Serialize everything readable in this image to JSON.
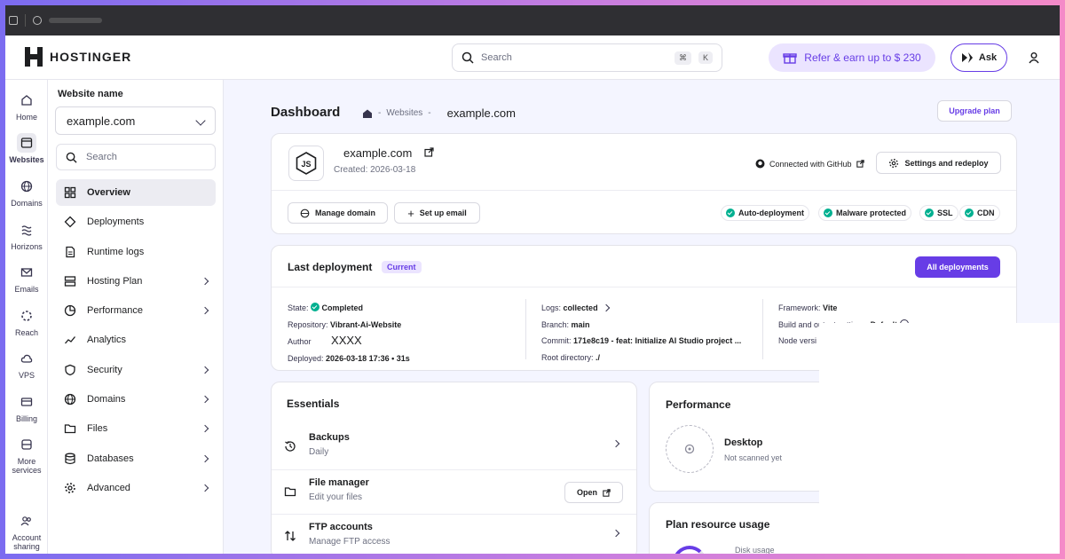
{
  "header": {
    "brand": "HOSTINGER",
    "search_placeholder": "Search",
    "shortcut_cmd": "⌘",
    "shortcut_key": "K",
    "refer_label": "Refer & earn up to $ 230",
    "ask_label": "Ask"
  },
  "rail": [
    {
      "label": "Home",
      "icon": "home-icon"
    },
    {
      "label": "Websites",
      "icon": "websites-icon",
      "active": true
    },
    {
      "label": "Domains",
      "icon": "globe-icon"
    },
    {
      "label": "Horizons",
      "icon": "horizons-icon"
    },
    {
      "label": "Emails",
      "icon": "mail-icon"
    },
    {
      "label": "Reach",
      "icon": "reach-icon"
    },
    {
      "label": "VPS",
      "icon": "cloud-icon"
    },
    {
      "label": "Billing",
      "icon": "card-icon"
    },
    {
      "label": "More",
      "label2": "services",
      "icon": "more-services-icon"
    },
    {
      "label": "Account",
      "label2": "sharing",
      "icon": "users-icon"
    }
  ],
  "sidebar": {
    "heading": "Website name",
    "selected_site": "example.com",
    "search_placeholder": "Search",
    "items": [
      {
        "label": "Overview",
        "icon": "grid-icon",
        "active": true
      },
      {
        "label": "Deployments",
        "icon": "deploy-icon"
      },
      {
        "label": "Runtime logs",
        "icon": "file-icon"
      },
      {
        "label": "Hosting Plan",
        "icon": "server-icon",
        "chevron": true
      },
      {
        "label": "Performance",
        "icon": "pie-icon",
        "chevron": true
      },
      {
        "label": "Analytics",
        "icon": "chart-line-icon"
      },
      {
        "label": "Security",
        "icon": "shield-icon",
        "chevron": true
      },
      {
        "label": "Domains",
        "icon": "globe-icon",
        "chevron": true
      },
      {
        "label": "Files",
        "icon": "folder-icon",
        "chevron": true
      },
      {
        "label": "Databases",
        "icon": "database-icon",
        "chevron": true
      },
      {
        "label": "Advanced",
        "icon": "gear-icon",
        "chevron": true
      }
    ]
  },
  "page": {
    "title": "Dashboard",
    "crumb_sep": "-",
    "crumb_websites": "Websites",
    "crumb_domain": "example.com",
    "upgrade_label": "Upgrade plan"
  },
  "site_card": {
    "domain": "example.com",
    "created": "Created: 2026-03-18",
    "github_label": "Connected with GitHub",
    "settings_label": "Settings and redeploy",
    "manage_domain": "Manage domain",
    "setup_email": "Set up email",
    "badges": [
      "Auto-deployment",
      "Malware protected",
      "SSL",
      "CDN"
    ]
  },
  "deployment": {
    "title": "Last deployment",
    "tag": "Current",
    "all_label": "All deployments",
    "state_k": "State:",
    "state_v": "Completed",
    "repo_k": "Repository:",
    "repo_v": "Vibrant-Ai-Website",
    "author_k": "Author",
    "author_v": "XXXX",
    "deployed_k": "Deployed:",
    "deployed_v": "2026-03-18 17:36 • 31s",
    "logs_k": "Logs:",
    "logs_v": "collected",
    "branch_k": "Branch:",
    "branch_v": "main",
    "commit_k": "Commit:",
    "commit_v": "171e8c19 - feat: Initialize AI Studio project ...",
    "root_k": "Root directory:",
    "root_v": "./",
    "framework_k": "Framework:",
    "framework_v": "Vite",
    "build_k": "Build and output settings:",
    "build_v": "Default",
    "node_k": "Node versi"
  },
  "essentials": {
    "title": "Essentials",
    "rows": [
      {
        "title": "Backups",
        "sub": "Daily",
        "icon": "history-icon"
      },
      {
        "title": "File manager",
        "sub": "Edit your files",
        "icon": "folder-icon",
        "action": "Open"
      },
      {
        "title": "FTP accounts",
        "sub": "Manage FTP access",
        "icon": "transfer-icon"
      }
    ]
  },
  "performance": {
    "title": "Performance",
    "device": "Desktop",
    "status": "Not scanned yet"
  },
  "resources": {
    "title": "Plan resource usage",
    "disk": "Disk usage"
  }
}
